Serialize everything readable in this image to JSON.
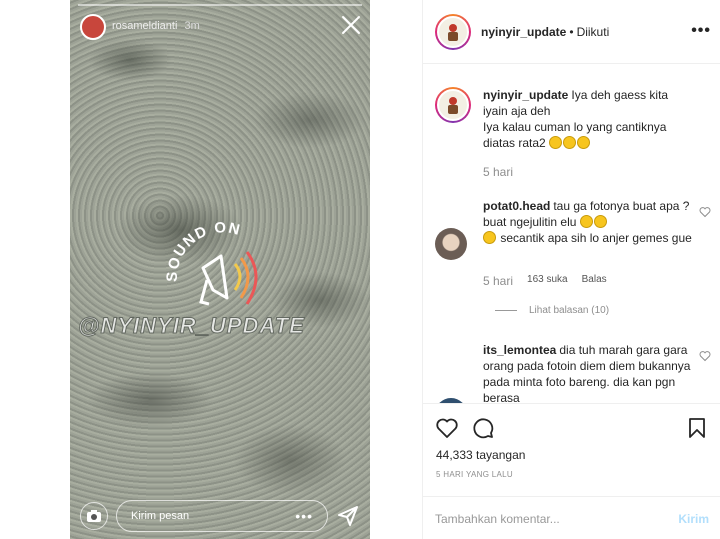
{
  "story": {
    "username": "rosameldianti",
    "time": "3m",
    "sticker_text": "SOUND ON",
    "watermark": "@NYINYIR_UPDATE",
    "message_placeholder": "Kirim pesan",
    "more": "•••"
  },
  "header": {
    "username": "nyinyir_update",
    "separator": "•",
    "follow_status": "Diikuti",
    "more": "•••"
  },
  "comments": [
    {
      "username": "nyinyir_update",
      "text_line1": "Iya deh gaess kita iyain aja deh",
      "text_line2": "Iya kalau cuman lo yang cantiknya diatas rata2",
      "time": "5 hari"
    },
    {
      "username": "potat0.head",
      "text_a": "tau ga fotonya buat apa ? buat ngejulitin elu",
      "text_b": "secantik apa sih lo anjer gemes gue",
      "time": "5 hari",
      "likes": "163 suka",
      "reply": "Balas",
      "view_replies": "Lihat balasan (10)"
    },
    {
      "username": "its_lemontea",
      "text": "dia tuh marah gara gara orang pada fotoin diem diem bukannya pada minta foto bareng. dia kan pgn berasa"
    }
  ],
  "footer": {
    "views": "44,333 tayangan",
    "time_ago": "5 HARI YANG LALU",
    "comment_placeholder": "Tambahkan komentar...",
    "post_label": "Kirim"
  },
  "colors": {
    "accent_disabled": "#b2dffc",
    "muted": "#8e8e8e"
  }
}
